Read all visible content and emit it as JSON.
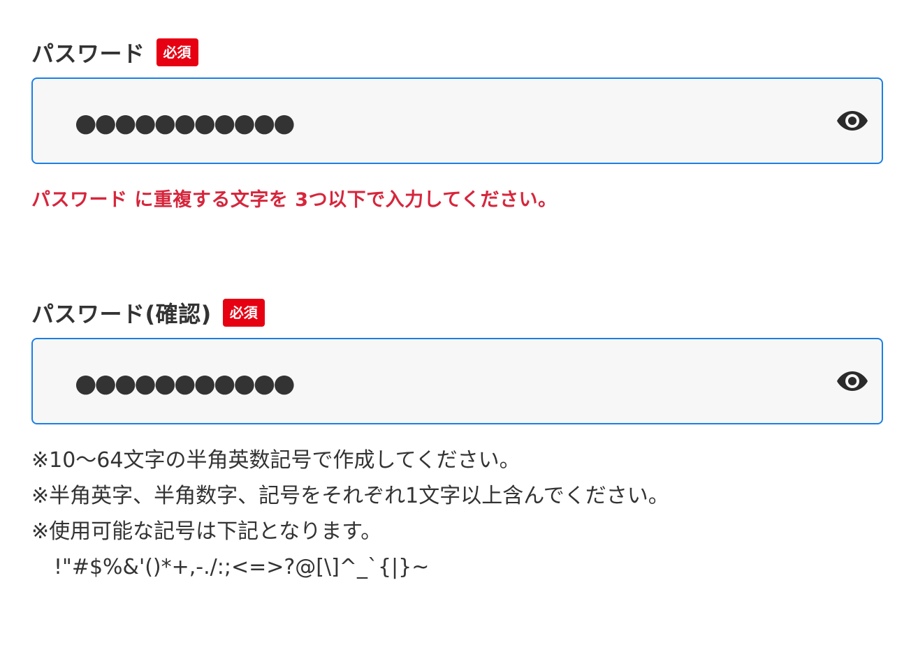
{
  "password": {
    "label": "パスワード",
    "required_badge": "必須",
    "masked_value": "●●●●●●●●●●●",
    "toggle_icon": "eye-icon",
    "error": "パスワード に重複する文字を 3つ以下で入力してください。"
  },
  "password_confirm": {
    "label": "パスワード(確認)",
    "required_badge": "必須",
    "masked_value": "●●●●●●●●●●●",
    "toggle_icon": "eye-icon"
  },
  "notes": [
    "※10〜64文字の半角英数記号で作成してください。",
    "※半角英字、半角数字、記号をそれぞれ1文字以上含んでください。",
    "※使用可能な記号は下記となります。",
    "!\"#$%&'()*+,-./:;<=>?@[\\]^_`{|}~"
  ],
  "colors": {
    "badge_bg": "#e60012",
    "error_text": "#d6263c",
    "input_border": "#1a7fe6",
    "input_bg": "#f7f7f7",
    "text": "#333333"
  }
}
